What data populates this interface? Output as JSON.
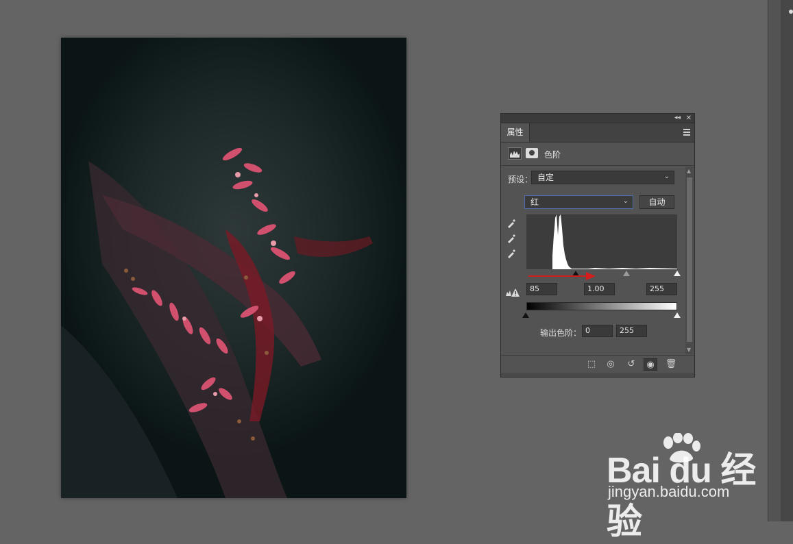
{
  "panel": {
    "tab_label": "属性",
    "adjustment_title": "色阶",
    "preset_label": "预设：",
    "preset_value": "自定",
    "channel_value": "红",
    "auto_button": "自动",
    "input_black": "85",
    "input_gamma": "1.00",
    "input_white": "255",
    "output_label": "输出色阶：",
    "output_black": "0",
    "output_white": "255"
  },
  "icons": {
    "collapse": "double-chevron-left-icon",
    "close": "close-icon",
    "panel_menu": "hamburger-menu-icon",
    "levels": "histogram-icon",
    "mask": "mask-icon",
    "eyedroppers": [
      "black-point-eyedropper-icon",
      "gray-point-eyedropper-icon",
      "white-point-eyedropper-icon"
    ],
    "clipping_warning": "warning-icon",
    "footer": [
      "clip-to-layer-icon",
      "view-previous-state-icon",
      "reset-icon",
      "visibility-eye-icon",
      "trash-icon"
    ]
  },
  "colors": {
    "panel_bg": "#535353",
    "workspace_bg": "#646464",
    "annotation_arrow": "#d41e1e",
    "channel_focus": "#4f6fa8"
  },
  "watermark": {
    "brand_text": "Bai du 经验",
    "url": "jingyan.baidu.com"
  }
}
